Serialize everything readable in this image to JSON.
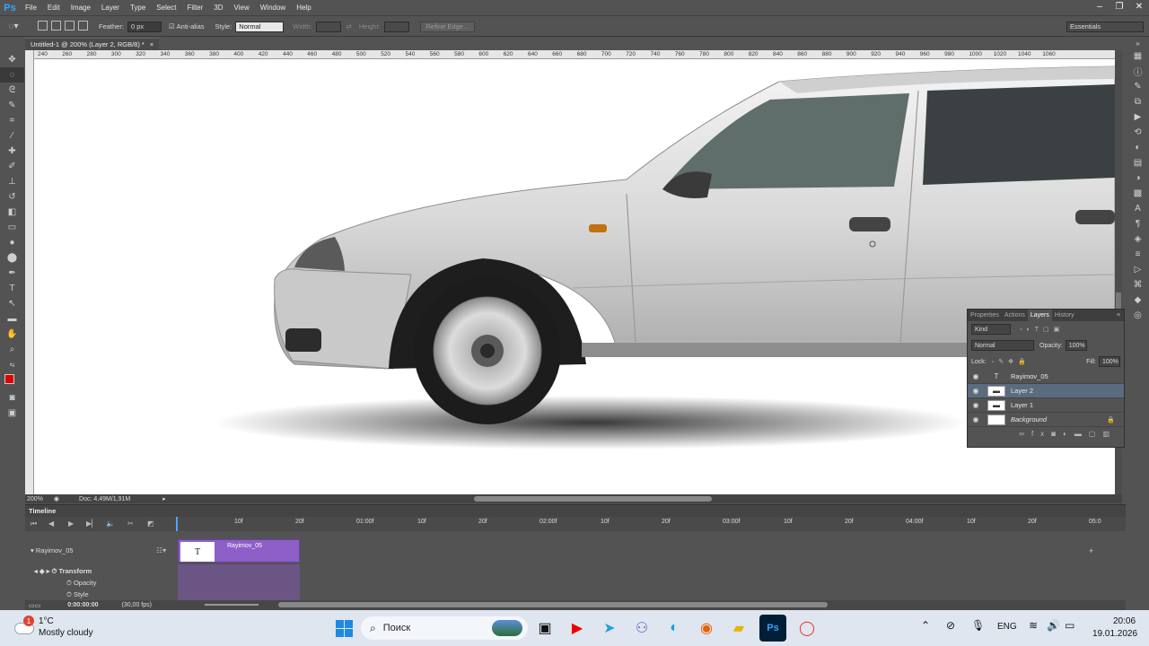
{
  "app": {
    "logo": "Ps",
    "menu": [
      "File",
      "Edit",
      "Image",
      "Layer",
      "Type",
      "Select",
      "Filter",
      "3D",
      "View",
      "Window",
      "Help"
    ],
    "window_controls": [
      "–",
      "❐",
      "✕"
    ]
  },
  "options_bar": {
    "feather_label": "Feather:",
    "feather_value": "0 px",
    "antialias_label": "Anti-alias",
    "style_label": "Style:",
    "style_value": "Normal",
    "width_label": "Width:",
    "height_label": "Height:",
    "refine_edge": "Refine Edge...",
    "workspace": "Essentials"
  },
  "document": {
    "tab_title": "Untitled-1 @ 200% (Layer 2, RGB/8) *",
    "tab_close": "×",
    "zoom": "200%",
    "doc_info": "Doc: 4,49M/1,91M"
  },
  "ruler_top_labels": [
    "240",
    "260",
    "280",
    "300",
    "320",
    "340",
    "360",
    "380",
    "400",
    "420",
    "440",
    "460",
    "480",
    "500",
    "520",
    "540",
    "560",
    "580",
    "600",
    "620",
    "640",
    "660",
    "680",
    "700",
    "720",
    "740",
    "760",
    "780",
    "800",
    "820",
    "840",
    "860",
    "880",
    "900",
    "920",
    "940",
    "960",
    "980",
    "1000",
    "1020",
    "1040",
    "1060"
  ],
  "layers_panel": {
    "tabs": [
      "Properties",
      "Actions",
      "Layers",
      "History"
    ],
    "active_tab": "Layers",
    "filter_kind": "Kind",
    "blend_mode": "Normal",
    "opacity_label": "Opacity:",
    "opacity_value": "100%",
    "lock_label": "Lock:",
    "fill_label": "Fill:",
    "fill_value": "100%",
    "layers": [
      {
        "name": "Rayimov_05",
        "type": "text",
        "selected": false
      },
      {
        "name": "Layer 2",
        "type": "pixel",
        "selected": true
      },
      {
        "name": "Layer 1",
        "type": "pixel",
        "selected": false
      },
      {
        "name": "Background",
        "type": "background",
        "selected": false
      }
    ],
    "footer_icons": [
      "link-icon",
      "fx-icon",
      "mask-icon",
      "adjustment-icon",
      "folder-icon",
      "new-layer-icon",
      "trash-icon"
    ]
  },
  "timeline": {
    "title": "Timeline",
    "ruler_labels": [
      "10f",
      "20f",
      "01:00f",
      "10f",
      "20f",
      "02:00f",
      "10f",
      "20f",
      "03:00f",
      "10f",
      "20f",
      "04:00f",
      "10f",
      "20f",
      "05:0"
    ],
    "layer_name": "Rayimov_05",
    "clip_name": "Rayimov_05",
    "clip_thumb": "T",
    "properties": [
      "Transform",
      "Opacity",
      "Style"
    ],
    "current_time": "0:00:00:00",
    "fps": "(30,00 fps)"
  },
  "taskbar": {
    "weather_temp": "1°C",
    "weather_desc": "Mostly cloudy",
    "search_placeholder": "Поиск",
    "language": "ENG",
    "time": "20:06",
    "date": "19.01.2026",
    "notification_badge": "1"
  }
}
